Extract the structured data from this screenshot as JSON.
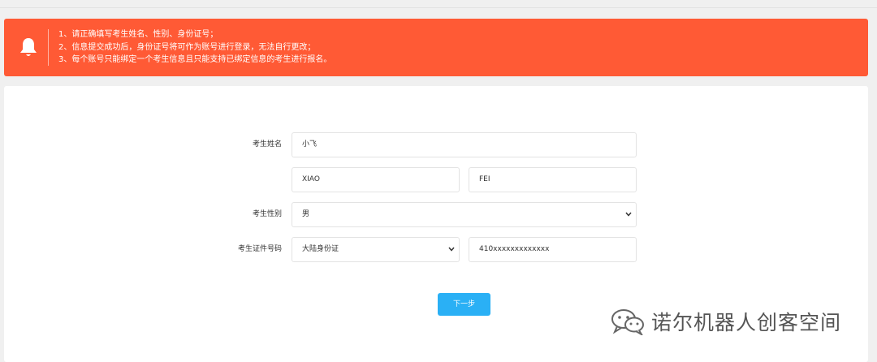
{
  "notice": {
    "icon": "bell-icon",
    "color": "#ff5a35",
    "lines": [
      "1、请正确填写考生姓名、性别、身份证号；",
      "2、信息提交成功后，身份证号将可作为账号进行登录，无法自行更改；",
      "3、每个账号只能绑定一个考生信息且只能支持已绑定信息的考生进行报名。"
    ]
  },
  "form": {
    "name_label": "考生姓名",
    "name_value": "小飞",
    "surname_pinyin": "XIAO",
    "given_pinyin": "FEI",
    "gender_label": "考生性别",
    "gender_value": "男",
    "id_label": "考生证件号码",
    "id_type_value": "大陆身份证",
    "id_number": "410xxxxxxxxxxxxx"
  },
  "next_button": {
    "label": "下一步",
    "color": "#2ab0f5"
  },
  "watermark": {
    "text": "诺尔机器人创客空间",
    "icon": "wechat-icon"
  }
}
